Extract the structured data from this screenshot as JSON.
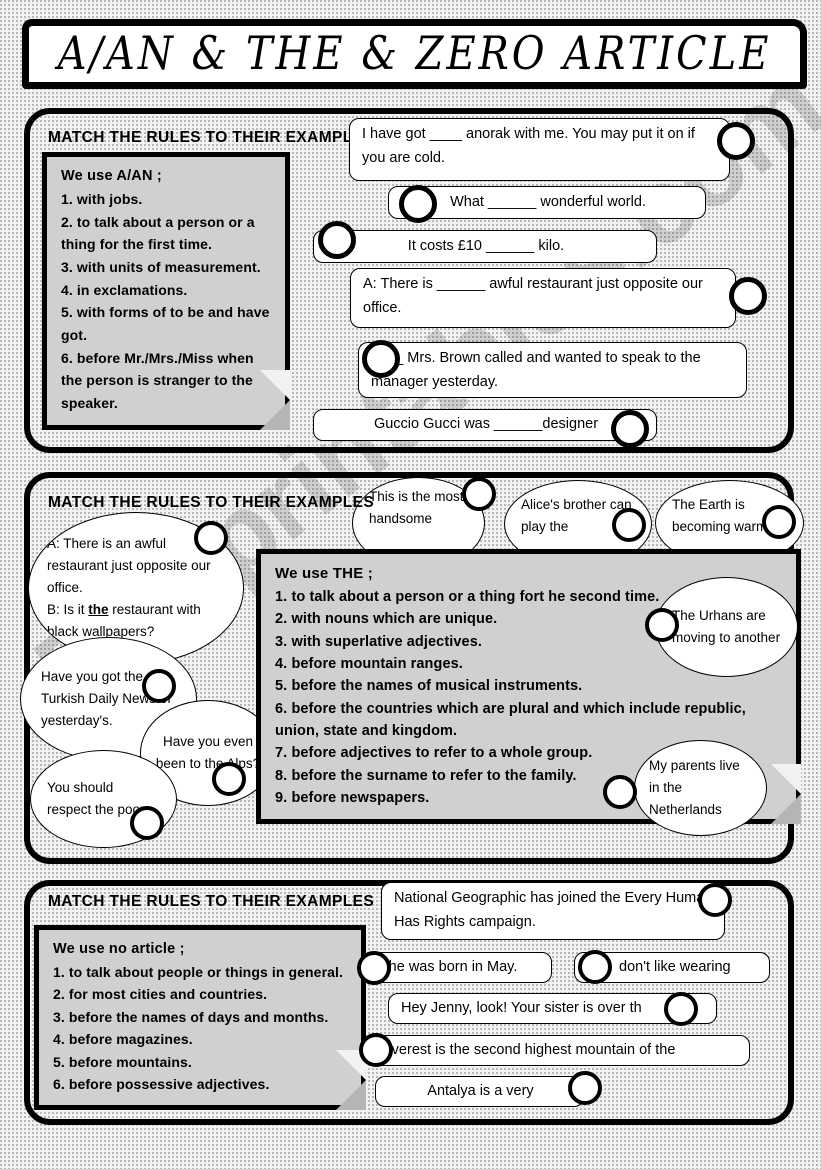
{
  "page": {
    "title": "A/AN & THE  &  ZERO ARTICLE",
    "watermark": "ESLprintables.com"
  },
  "sections": [
    {
      "id": "section-1",
      "heading": "MATCH THE RULES TO THEIR EXAMPLES",
      "rules": {
        "title": "We use A/AN ;",
        "items": [
          "with jobs.",
          "to talk about a person or a thing for the first time.",
          "with units of measurement.",
          "in exclamations.",
          "with forms of to be and have got.",
          "before Mr./Mrs./Miss when the person is stranger to the speaker."
        ]
      },
      "examples": [
        "I have got ____ anorak with me. You may put it on if you are cold.",
        "What ______ wonderful world.",
        "It costs £10 ______ kilo.",
        "A: There is ______ awful restaurant just opposite our office.",
        "____ Mrs. Brown called and wanted to speak to the manager yesterday.",
        "Guccio Gucci was ______designer"
      ]
    },
    {
      "id": "section-2",
      "heading": "MATCH THE RULES TO THEIR EXAMPLES",
      "rules": {
        "title": "We use THE ;",
        "items": [
          "to talk about a person or a thing fort he second time.",
          "with nouns which are unique.",
          "with superlative adjectives.",
          "before mountain ranges.",
          "before the names of musical instruments.",
          "before the countries which are plural and which include republic, union, state and kingdom.",
          "before adjectives to refer to a whole group.",
          "before the surname to refer to the family.",
          "before newspapers."
        ]
      },
      "examples": [
        "This is the most handsome",
        "Alice's brother can play the",
        "The Earth is becoming warmer.",
        "A: There is an awful restaurant just opposite our office.",
        "B: Is it the restaurant with black wallpapers?",
        "The Urhans are moving to another",
        "Have you got the Turkish Daily News of yesterday's.",
        "Have you even been to the Alps?",
        "My parents live in the Netherlands",
        "You should respect the poor."
      ]
    },
    {
      "id": "section-3",
      "heading": "MATCH THE RULES TO THEIR EXAMPLES",
      "rules": {
        "title": "We use no article ;",
        "items": [
          "to talk about people or things in general.",
          "for most cities and countries.",
          "before the names of days and months.",
          "before magazines.",
          "before mountains.",
          "before possessive adjectives."
        ]
      },
      "examples": [
        "National Geographic has joined the Every Human Has Rights campaign.",
        "She was born in May.",
        "don't like wearing",
        "Hey Jenny, look! Your sister is over th",
        "Everest is the second highest mountain of the",
        "Antalya is a very"
      ]
    }
  ]
}
